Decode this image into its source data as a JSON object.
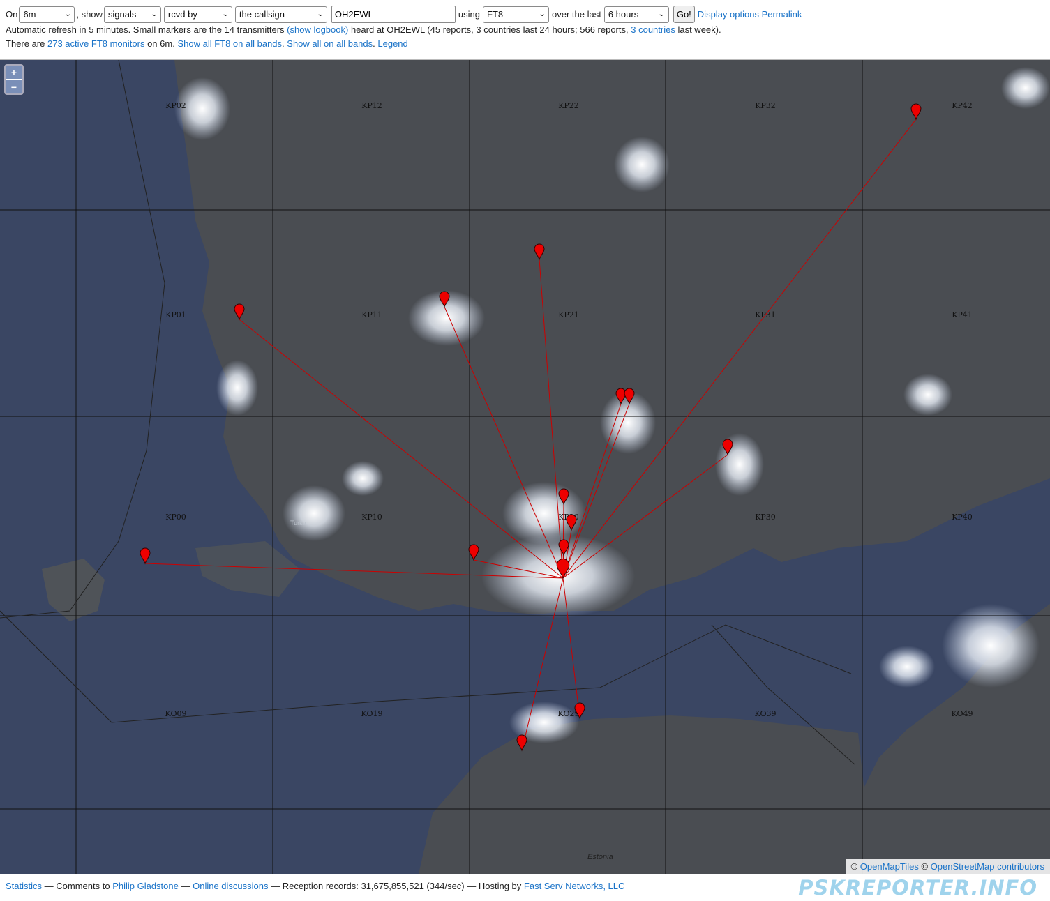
{
  "controls": {
    "on_label": "On",
    "band": "6m",
    "show_label": ", show",
    "show_what": "signals",
    "direction": "rcvd by",
    "target": "the callsign",
    "callsign": "OH2EWL",
    "using_label": "using",
    "mode": "FT8",
    "over_label": "over the last",
    "period": "6 hours",
    "go": "Go!",
    "display_options": "Display options",
    "permalink": "Permalink"
  },
  "status": {
    "part1": "Automatic refresh in 5 minutes. Small markers are the 14 transmitters",
    "logbook_link": "(show logbook)",
    "part2": "heard at OH2EWL (45 reports, 3 countries last 24 hours; 566 reports,",
    "countries_link": "3 countries",
    "part3": "last week)."
  },
  "monitors": {
    "there_are": "There are",
    "monitors_link": "273 active FT8 monitors",
    "on_band": "on 6m.",
    "show_ft8_link": "Show all FT8 on all bands",
    "show_all_link": "Show all on all bands",
    "legend_link": "Legend"
  },
  "map": {
    "zoom_in": "+",
    "zoom_out": "−",
    "grid_squares": [
      "KP02",
      "KP12",
      "KP22",
      "KP32",
      "KP42",
      "KP01",
      "KP11",
      "KP21",
      "KP31",
      "KP41",
      "KP00",
      "KP10",
      "KP20",
      "KP30",
      "KP40",
      "KO09",
      "KO19",
      "KO29",
      "KO39",
      "KO49"
    ],
    "place_labels": [
      "Turku",
      "Estonia"
    ],
    "marker_color": "#ee0000",
    "path_color": "#cc0000",
    "attribution_openmaptiles": "OpenMapTiles",
    "attribution_osm": "OpenStreetMap contributors",
    "copyright_sign": "©"
  },
  "footer": {
    "statistics": "Statistics",
    "sep1": "— Comments to",
    "author": "Philip Gladstone",
    "sep2": "—",
    "discussions": "Online discussions",
    "sep3": "— Reception records: 31,675,855,521 (344/sec) — Hosting by",
    "host": "Fast Serv Networks, LLC",
    "brand": "PSKREPORTER.INFO"
  }
}
